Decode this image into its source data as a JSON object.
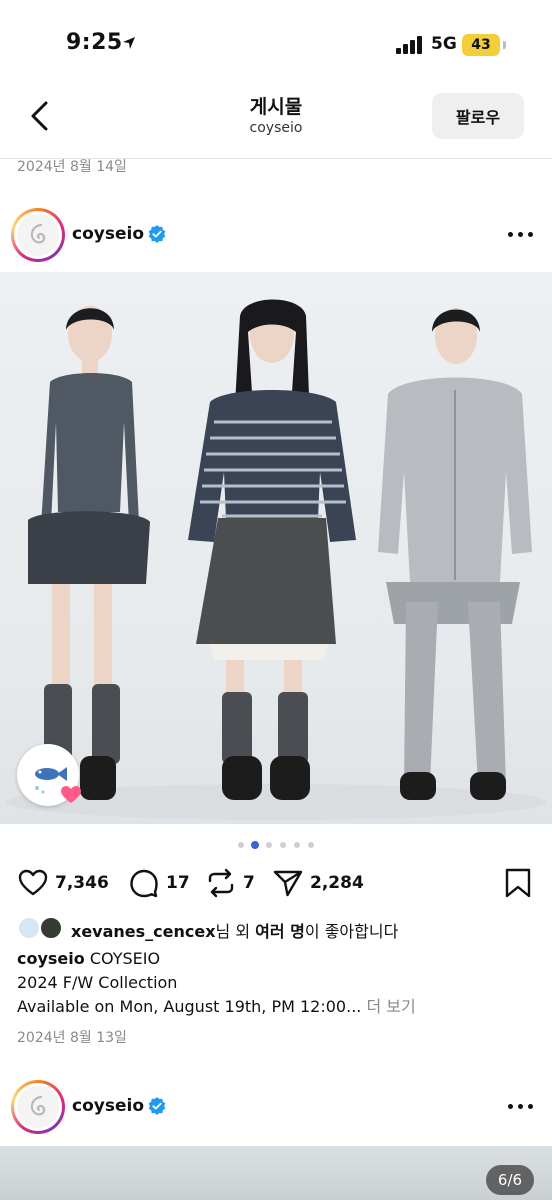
{
  "status_bar": {
    "time": "9:25",
    "network": "5G",
    "battery": "43"
  },
  "header": {
    "title": "게시물",
    "subtitle": "coyseio",
    "follow_label": "팔로우"
  },
  "previous_post": {
    "date": "2024년 8월 14일"
  },
  "post": {
    "username": "coyseio",
    "likes": "7,346",
    "comments": "17",
    "reposts": "7",
    "shares": "2,284",
    "liked_by_user": "xevanes_cencex",
    "liked_by_suffix": "님 외 ",
    "liked_by_others": "여러 명",
    "liked_by_end": "이 좋아합니다",
    "caption_user": "coyseio",
    "caption_line1": "COYSEIO",
    "caption_line2": "2024 F/W Collection",
    "caption_line3": "Available on Mon, August 19th, PM 12:00...",
    "more_label": "더 보기",
    "date": "2024년 8월 13일",
    "carousel_total": 6,
    "carousel_active": 1
  },
  "next_post": {
    "username": "coyseio",
    "counter": "6/6"
  },
  "colors": {
    "accent": "#3a64d8",
    "verified": "#1d9bf0",
    "battery": "#f2cf3a"
  }
}
